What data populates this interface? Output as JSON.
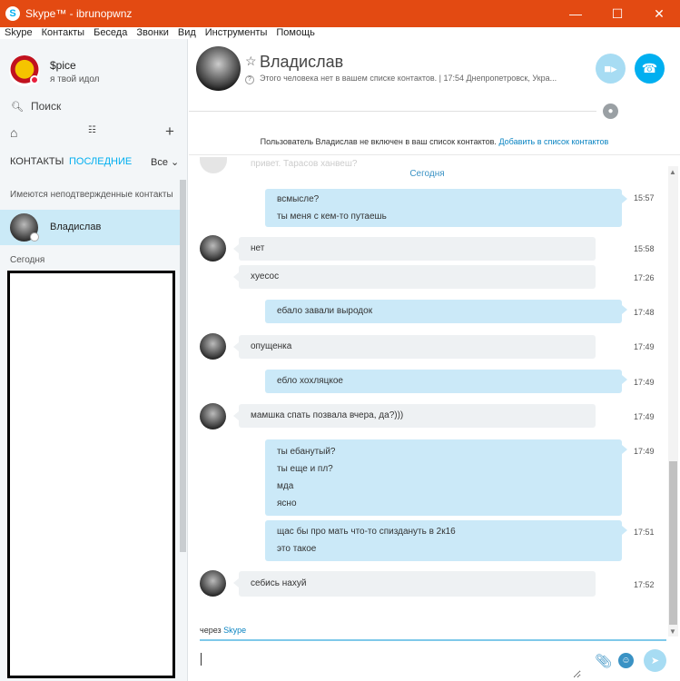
{
  "window": {
    "title": "Skype™ - ibrunopwnz",
    "app_icon": "S",
    "minimize": "—",
    "maximize": "☐",
    "close": "✕"
  },
  "menu": [
    "Skype",
    "Контакты",
    "Беседа",
    "Звонки",
    "Вид",
    "Инструменты",
    "Помощь"
  ],
  "profile": {
    "name": "$pice",
    "mood": "я твой идол",
    "status": "do-not-disturb"
  },
  "search": {
    "label": "Поиск"
  },
  "tabs": {
    "contacts": "КОНТАКТЫ",
    "recent": "ПОСЛЕДНИЕ",
    "filter": "Все"
  },
  "sidebar": {
    "pending_label": "Имеются неподтвержденные контакты",
    "contact_name": "Владислав",
    "today_label": "Сегодня"
  },
  "conversation": {
    "name": "Владислав",
    "subtitle": "Этого человека нет в вашем списке контактов.  |  17:54 Днепропетровск, Укра...",
    "notice": "Пользователь Владислав не включен в ваш список контактов.",
    "notice_link": "Добавить в список контактов",
    "faded_text": "привет. Тарасов ханвеш?",
    "day_separator": "Сегодня"
  },
  "messages": [
    {
      "dir": "out",
      "lines": [
        "всмысле?",
        "ты меня с кем-то путаешь"
      ],
      "time": "15:57"
    },
    {
      "dir": "in",
      "lines": [
        "нет"
      ],
      "time": "15:58"
    },
    {
      "dir": "in",
      "lines": [
        "хуесос"
      ],
      "time": "17:26"
    },
    {
      "dir": "out",
      "lines": [
        "ебало завали выродок"
      ],
      "time": "17:48"
    },
    {
      "dir": "in",
      "lines": [
        "опущенка"
      ],
      "time": "17:49"
    },
    {
      "dir": "out",
      "lines": [
        "ебло хохляцкое"
      ],
      "time": "17:49"
    },
    {
      "dir": "in",
      "lines": [
        "мамшка спать позвала вчера, да?)))"
      ],
      "time": "17:49"
    },
    {
      "dir": "out",
      "lines": [
        "ты ебанутый?",
        "ты еще и пл?",
        "мда",
        "ясно"
      ],
      "time": "17:49"
    },
    {
      "dir": "out",
      "lines": [
        "щас бы про мать что-то спиздануть в 2к16",
        "это такое"
      ],
      "time": "17:51"
    },
    {
      "dir": "in",
      "lines": [
        "себись нахуй"
      ],
      "time": "17:52"
    }
  ],
  "composer": {
    "via_prefix": "через ",
    "via_link": "Skype",
    "value": ""
  },
  "colors": {
    "titlebar": "#e34a12",
    "accent": "#00aff0",
    "bubble_out": "#cbe9f8",
    "bubble_in": "#eef1f3"
  }
}
